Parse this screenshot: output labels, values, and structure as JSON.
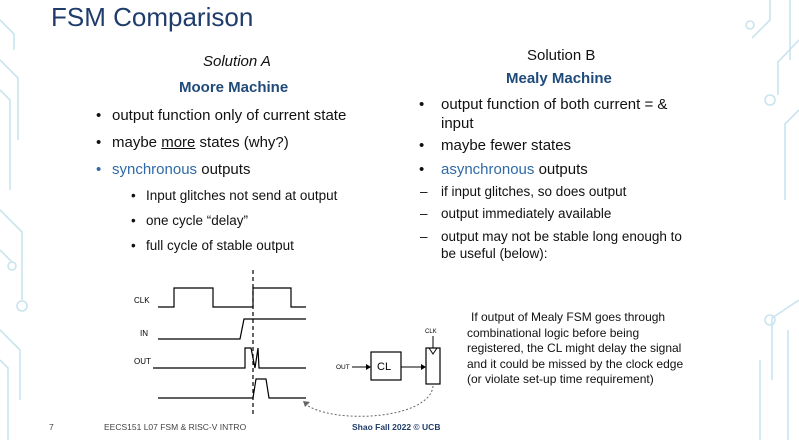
{
  "title": "FSM Comparison",
  "solution_a": {
    "heading": "Solution A",
    "subheading": "Moore Machine",
    "bullets": [
      "output function only of current state",
      "(why?)",
      "synchronous",
      "outputs"
    ],
    "bullet_more_prefix": "maybe ",
    "bullet_more_word": "more",
    "bullet_more_suffix": " states (why?)",
    "sub_bullets": [
      "Input glitches not send at output",
      "one cycle “delay”",
      "full cycle of stable output"
    ]
  },
  "solution_b": {
    "heading": "Solution B",
    "subheading": "Mealy Machine",
    "bullet1_line1": "output function of both current = &",
    "bullet1_line2": "input",
    "bullet2": "maybe fewer states",
    "bullet3_word": "asynchronous",
    "bullet3_rest": " outputs",
    "dashes": [
      "if input glitches, so does output",
      "output immediately available",
      "output may not be stable long enough to",
      "be useful (below):"
    ]
  },
  "timing": {
    "clk_label": "CLK",
    "in_label": "IN",
    "out_label": "OUT"
  },
  "circuit": {
    "out_label": "OUT",
    "cl_label": "CL",
    "clk_label": "CLK"
  },
  "note_lines": [
    "If output of Mealy FSM goes through",
    "combinational logic before being",
    "registered, the CL might delay the signal",
    "and it could be missed by the clock edge",
    "(or violate set-up time requirement)"
  ],
  "footer": {
    "page": "7",
    "course": "EECS151 L07 FSM & RISC-V INTRO",
    "credit": "Shao Fall 2022 © UCB"
  },
  "colors": {
    "title": "#1f3d6b",
    "subheading": "#1f4a7a",
    "accent": "#2f6aa8",
    "decor": "#bfe0ec"
  }
}
